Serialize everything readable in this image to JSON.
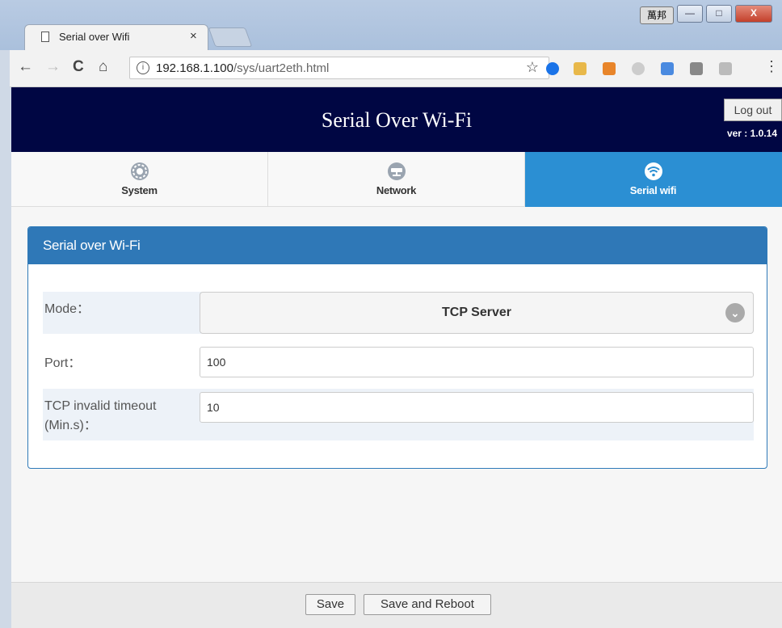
{
  "browser": {
    "tab_title": "Serial over Wifi",
    "tab_close": "×",
    "language_button": "萬邦",
    "window_buttons": [
      "—",
      "□",
      "X"
    ],
    "url_host": "192.168.1.100",
    "url_path": "/sys/uart2eth.html",
    "info_glyph": "i",
    "star_glyph": "☆",
    "menu_glyph": "⋮",
    "nav": {
      "back": "←",
      "forward": "→",
      "reload": "C",
      "home": "⌂"
    },
    "extension_icons": [
      "g-icon",
      "puzzle-icon",
      "download-icon",
      "gmail-icon",
      "translate-icon",
      "s-icon",
      "drive-icon"
    ]
  },
  "header": {
    "title": "Serial Over Wi-Fi",
    "logout_label": "Log out",
    "version": "ver : 1.0.14"
  },
  "nav_tabs": [
    {
      "label": "System",
      "icon": "gear-icon",
      "active": false
    },
    {
      "label": "Network",
      "icon": "network-icon",
      "active": false
    },
    {
      "label": "Serial wifi",
      "icon": "wifi-icon",
      "active": true
    }
  ],
  "panel": {
    "title": "Serial over Wi-Fi",
    "mode_label": "Mode：",
    "mode_value": "TCP Server",
    "port_label": "Port：",
    "port_value": "100",
    "timeout_label_line1": "TCP invalid timeout",
    "timeout_label_line2": "(Min.s)：",
    "timeout_value": "10"
  },
  "footer": {
    "save_label": "Save",
    "save_reboot_label": "Save and Reboot"
  },
  "colors": {
    "header_bg": "#000643",
    "active_tab": "#2b8fd3",
    "panel_head": "#2f78b7"
  }
}
